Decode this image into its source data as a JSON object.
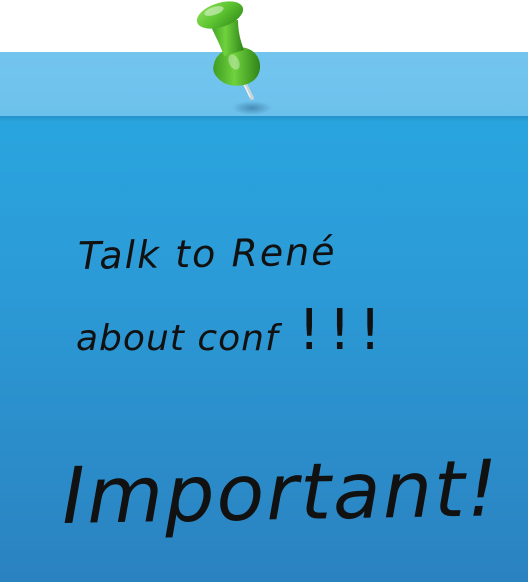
{
  "note": {
    "line1": "Talk to René",
    "line2": "about conf",
    "exclamation": "!!!",
    "emphasis": "Important!"
  },
  "colors": {
    "note_top": "#6cc1ec",
    "note_body_top": "#2aa9e2",
    "note_body_bottom": "#2b82c0",
    "pin_green": "#5cc330",
    "ink": "#111111"
  },
  "icons": {
    "pin": "push-pin-icon"
  }
}
